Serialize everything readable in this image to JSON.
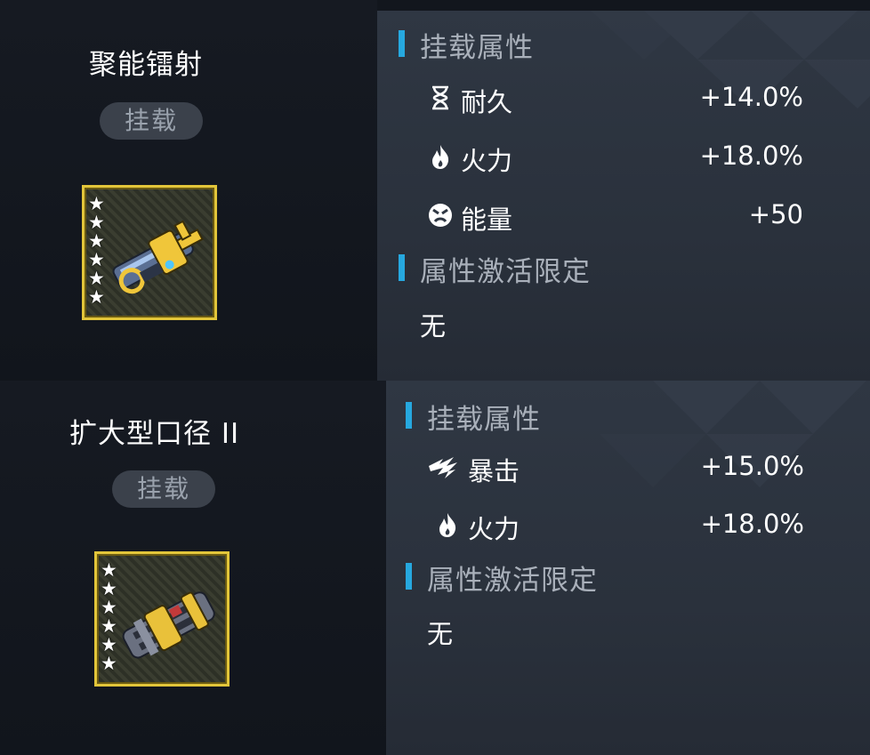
{
  "cards": [
    {
      "name": "聚能镭射",
      "badge": "挂载",
      "stars": 6,
      "section_attrs": "挂载属性",
      "attrs": [
        {
          "icon": "hourglass-icon",
          "label": "耐久",
          "value": "+14.0%"
        },
        {
          "icon": "flame-icon",
          "label": "火力",
          "value": "+18.0%"
        },
        {
          "icon": "energy-face-icon",
          "label": "能量",
          "value": "+50"
        }
      ],
      "section_limit": "属性激活限定",
      "limit_value": "无"
    },
    {
      "name": "扩大型口径 II",
      "badge": "挂载",
      "stars": 6,
      "section_attrs": "挂载属性",
      "attrs": [
        {
          "icon": "critical-icon",
          "label": "暴击",
          "value": "+15.0%"
        },
        {
          "icon": "flame-icon",
          "label": "火力",
          "value": "+18.0%"
        }
      ],
      "section_limit": "属性激活限定",
      "limit_value": "无"
    }
  ],
  "colors": {
    "accent_bar": "#26a8df",
    "frame_gold": "#e2c53a",
    "section_text": "#a9b0ba"
  }
}
